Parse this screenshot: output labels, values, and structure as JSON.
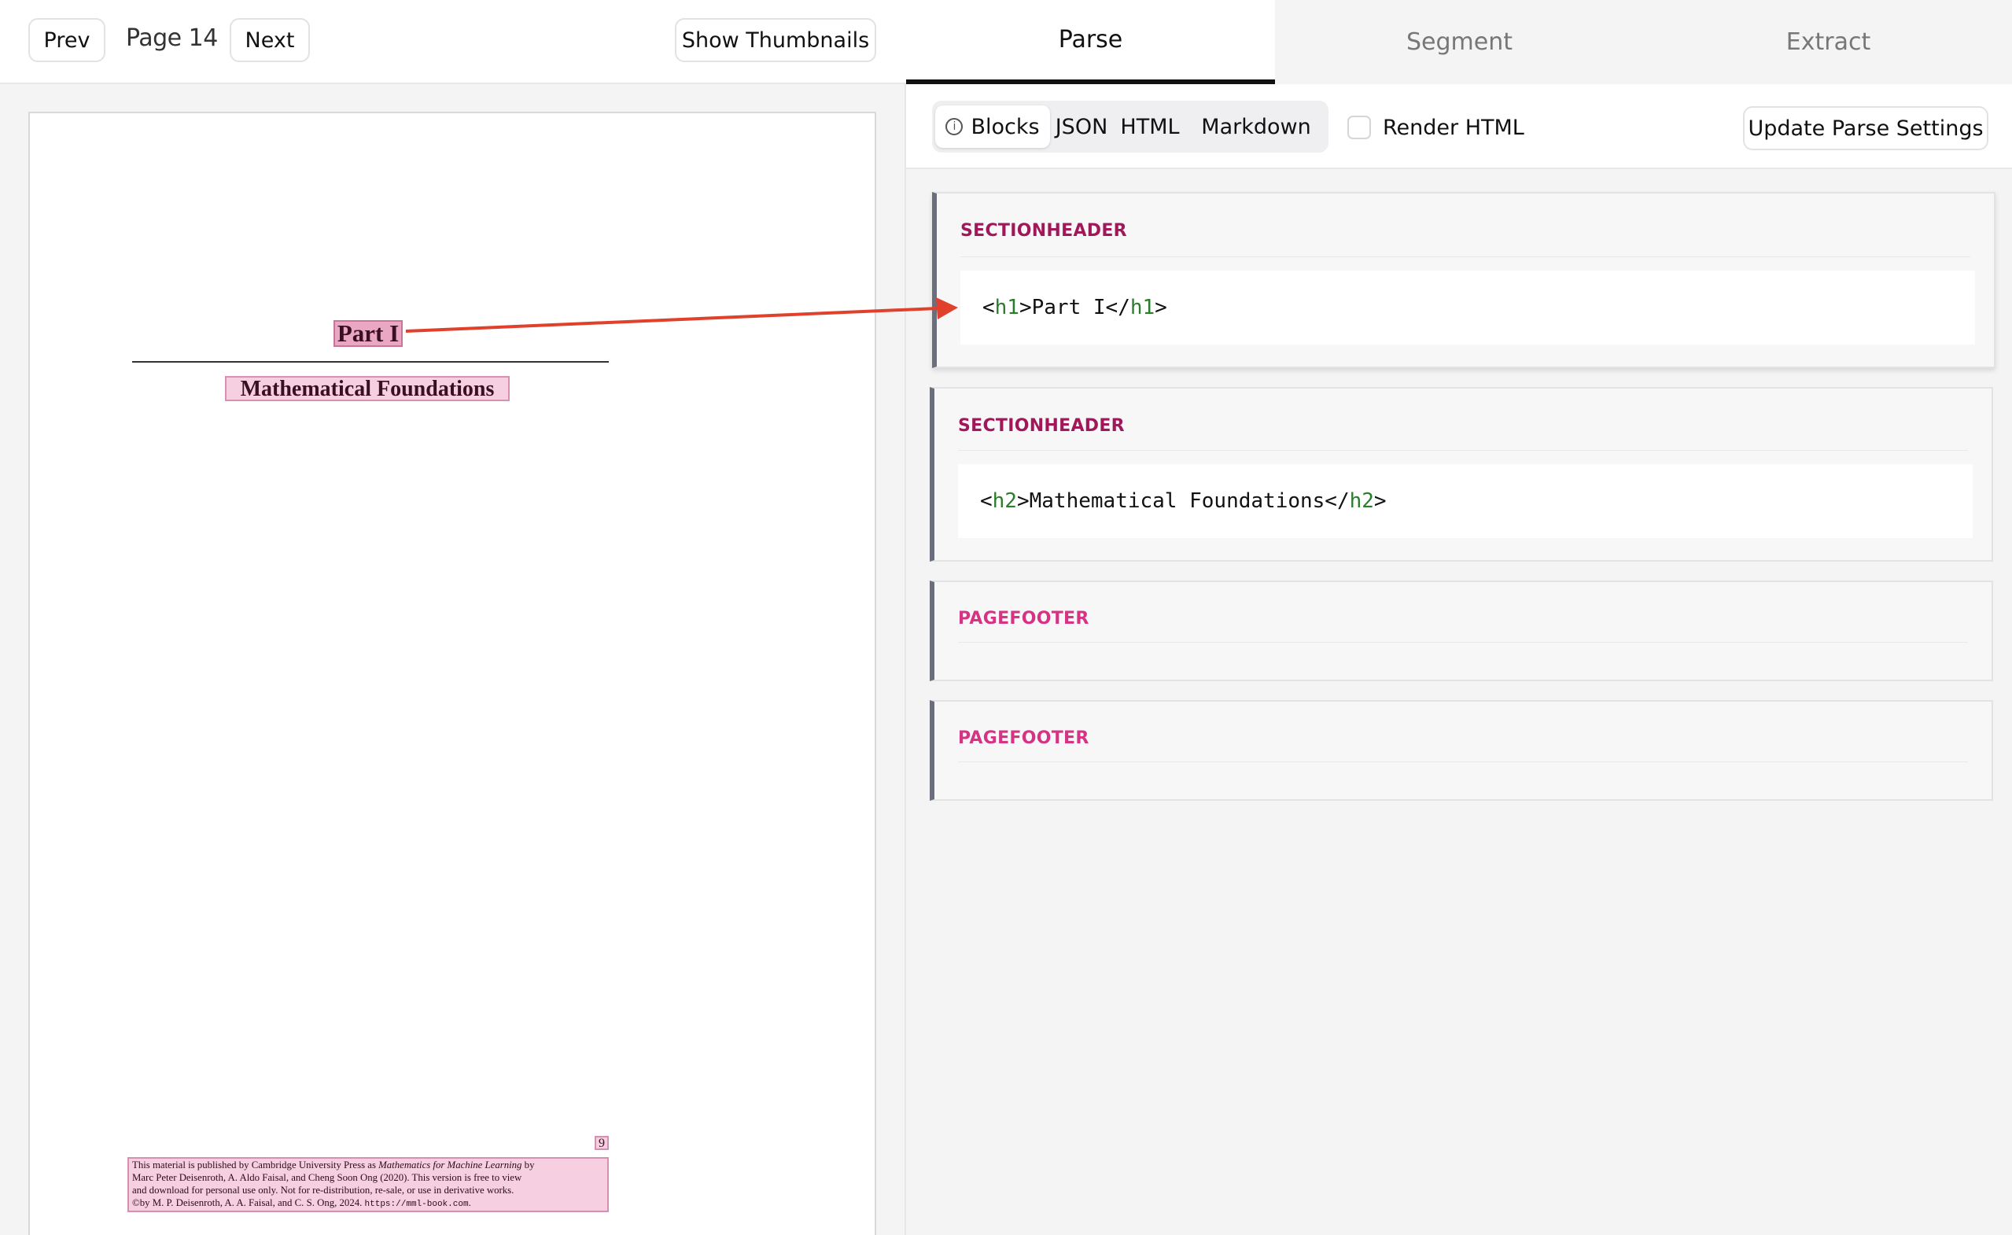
{
  "viewer": {
    "prev_label": "Prev",
    "page_label": "Page 14",
    "next_label": "Next",
    "thumbnails_label": "Show Thumbnails"
  },
  "document_page": {
    "part_title": "Part I",
    "subtitle": "Mathematical Foundations",
    "page_number": "9",
    "footer_line1_a": "This material is published by Cambridge University Press as ",
    "footer_line1_italic": "Mathematics for Machine Learning",
    "footer_line1_b": " by",
    "footer_line2": "Marc Peter Deisenroth, A. Aldo Faisal, and Cheng Soon Ong (2020). This version is free to view",
    "footer_line3": "and download for personal use only. Not for re-distribution, re-sale, or use in derivative works.",
    "footer_line4_a": "©by M. P. Deisenroth, A. A. Faisal, and C. S. Ong, 2024. ",
    "footer_line4_url": "https://mml-book.com",
    "footer_line4_end": "."
  },
  "tabs": [
    "Parse",
    "Segment",
    "Extract"
  ],
  "parse_toolbar": {
    "views": [
      "Blocks",
      "JSON",
      "HTML",
      "Markdown"
    ],
    "active_view": "Blocks",
    "render_html_label": "Render HTML",
    "render_html_checked": false,
    "update_label": "Update Parse Settings"
  },
  "blocks": [
    {
      "type": "SECTIONHEADER",
      "open_lt": "<",
      "tag": "h1",
      "text": ">Part I</",
      "close_tag": "h1",
      "close_gt": ">",
      "type_color": "#a0185a"
    },
    {
      "type": "SECTIONHEADER",
      "open_lt": "<",
      "tag": "h2",
      "text": ">Mathematical Foundations</",
      "close_tag": "h2",
      "close_gt": ">",
      "type_color": "#a0185a"
    },
    {
      "type": "PAGEFOOTER",
      "type_color": "#d63384"
    },
    {
      "type": "PAGEFOOTER",
      "type_color": "#d63384"
    }
  ],
  "colors": {
    "highlight": "#e9a7c3",
    "arrow": "#e0412c",
    "block_border": "#6b6e7c"
  }
}
